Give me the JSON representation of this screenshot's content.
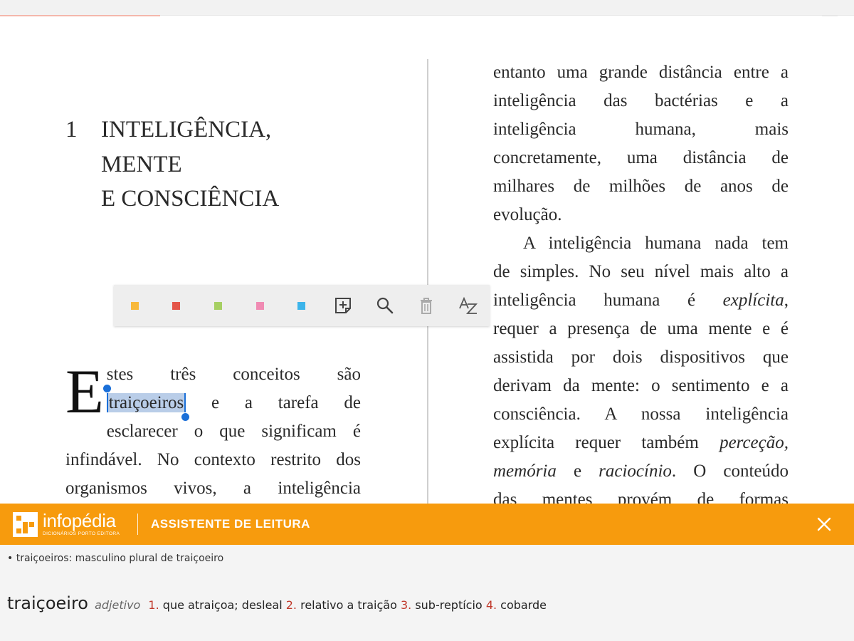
{
  "colors": {
    "accent": "#f79b0d",
    "selection": "#b9cde8",
    "handle": "#1a6fd8",
    "sense_number": "#c0392b"
  },
  "chapter": {
    "number": "1",
    "title_lines": [
      "INTELIGÊNCIA,",
      "MENTE",
      "E CONSCIÊNCIA"
    ]
  },
  "left_page": {
    "dropcap": "E",
    "line1": "stes três conceitos são",
    "selected_word": "traiçoeiros",
    "line2_rest": "e a tarefa de",
    "lines": [
      "esclarecer o que significam é",
      "infindável. No contexto restrito dos",
      "organismos vivos, a inteligência"
    ]
  },
  "right_page": {
    "lines": [
      "entanto uma grande distância entre a",
      "inteligência das bactérias e a",
      "inteligência humana, mais",
      "concretamente, uma distância de",
      "milhares de milhões de anos de",
      "evolução.",
      "A inteligência humana nada tem",
      "de simples. No seu nível mais alto a",
      "inteligência humana é",
      "explícita",
      ",",
      "requer a presença de uma mente e é",
      "assistida por dois dispositivos que",
      "derivam da mente: o sentimento e a",
      "consciência. A nossa inteligência",
      "explícita requer também",
      "perceção,",
      "memória",
      "e",
      "raciocínio",
      ". O conteúdo",
      "das mentes provém de formas"
    ]
  },
  "toolbar": {
    "swatches": [
      {
        "name": "highlight-yellow",
        "color": "#f8b93c"
      },
      {
        "name": "highlight-red",
        "color": "#e4564a"
      },
      {
        "name": "highlight-green",
        "color": "#a6cf63"
      },
      {
        "name": "highlight-pink",
        "color": "#f08bb3"
      },
      {
        "name": "highlight-blue",
        "color": "#3cb4ea"
      }
    ],
    "icons": [
      "add-note-icon",
      "search-icon",
      "trash-icon",
      "dictionary-az-icon"
    ]
  },
  "assistant": {
    "brand": "infopédia",
    "brand_sub": "DICIONÁRIOS PORTO EDITORA",
    "title": "ASSISTENTE DE LEITURA",
    "inflection": "• traiçoeiros: masculino plural de traiçoeiro",
    "headword": "traiçoeiro",
    "pos": "adjetivo",
    "senses": [
      {
        "num": "1.",
        "text": "que atraiçoa; desleal"
      },
      {
        "num": "2.",
        "text": "relativo a traição"
      },
      {
        "num": "3.",
        "text": "sub-reptício"
      },
      {
        "num": "4.",
        "text": "cobarde"
      }
    ]
  }
}
